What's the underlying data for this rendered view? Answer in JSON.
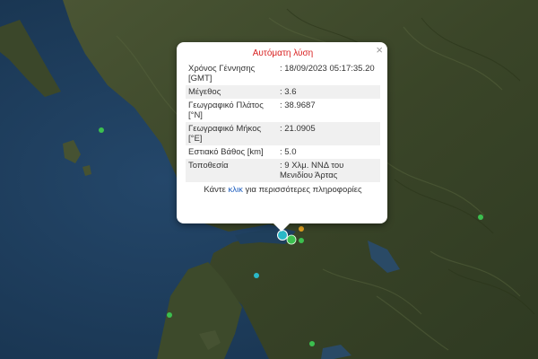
{
  "popup": {
    "title": "Αυτόματη λύση",
    "close_symbol": "×",
    "rows": [
      {
        "label": "Χρόνος Γέννησης [GMT]",
        "value": ": 18/09/2023 05:17:35.20"
      },
      {
        "label": "Μέγεθος",
        "value": ": 3.6"
      },
      {
        "label": "Γεωγραφικό Πλάτος [°N]",
        "value": ": 38.9687"
      },
      {
        "label": "Γεωγραφικό Μήκος [°E]",
        "value": ": 21.0905"
      },
      {
        "label": "Εστιακό Βάθος [km]",
        "value": ": 5.0"
      },
      {
        "label": "Τοποθεσία",
        "value": ": 9 Χλμ. ΝΝΔ του Μενιδίου Άρτας"
      }
    ],
    "footer": {
      "before": "Κάντε ",
      "link": "κλικ",
      "after": " για περισσότερες πληροφορίες"
    }
  },
  "colors": {
    "sea": "#1e3a52",
    "land": "#3f4a2c",
    "marker_green": "#3cbf4f",
    "marker_cyan": "#2ab8c8",
    "marker_orange": "#e0a020",
    "title_red": "#d81f1f",
    "link_blue": "#1f5fbf"
  }
}
